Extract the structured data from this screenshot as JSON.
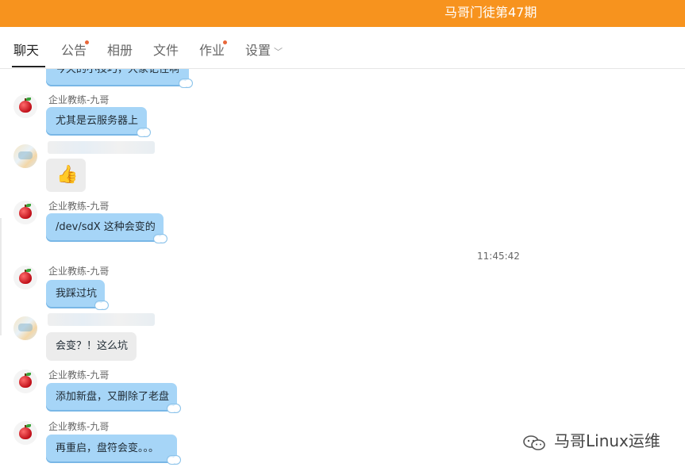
{
  "window": {
    "title": "马哥门徒第47期",
    "accent_color": "#f7931e"
  },
  "tabs": [
    {
      "label": "聊天",
      "active": true,
      "has_dot": false
    },
    {
      "label": "公告",
      "active": false,
      "has_dot": true
    },
    {
      "label": "相册",
      "active": false,
      "has_dot": false
    },
    {
      "label": "文件",
      "active": false,
      "has_dot": false
    },
    {
      "label": "作业",
      "active": false,
      "has_dot": true
    },
    {
      "label": "设置",
      "active": false,
      "has_dot": false,
      "icon": "chevron-down-icon"
    }
  ],
  "chat": {
    "partial_message": "今天的小技巧，大家记住啊",
    "messages": [
      {
        "sender": "企业教练-九哥",
        "text": "尤其是云服务器上",
        "avatar": "apple-icon"
      },
      {
        "sender": "",
        "text": "",
        "sticker": "thumbs-up-emoji",
        "avatar": "blurred-avatar"
      },
      {
        "sender": "企业教练-九哥",
        "text": "/dev/sdX 这种会变的",
        "avatar": "apple-icon"
      },
      {
        "timestamp": "11:45:42"
      },
      {
        "sender": "企业教练-九哥",
        "text": "我踩过坑",
        "avatar": "apple-icon"
      },
      {
        "sender": "",
        "text": "会变？！这么坑",
        "avatar": "blurred-avatar"
      },
      {
        "sender": "企业教练-九哥",
        "text": "添加新盘，又删除了老盘",
        "avatar": "apple-icon"
      },
      {
        "sender": "企业教练-九哥",
        "text": "再重启，盘符会变。。。",
        "avatar": "apple-icon"
      }
    ],
    "thumbs_up_glyph": "👍"
  },
  "watermark": {
    "text": "马哥Linux运维",
    "icon": "wechat-icon"
  }
}
